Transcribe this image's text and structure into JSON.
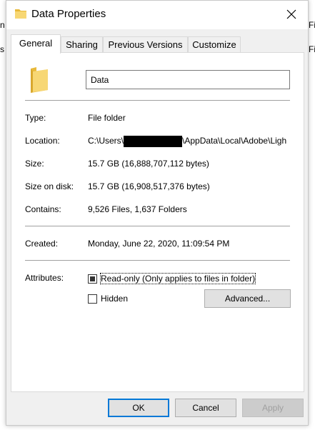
{
  "background": {
    "left_fragments": [
      "n",
      "s"
    ],
    "right_fragments": [
      "Fi",
      "Fi"
    ]
  },
  "window": {
    "title": "Data Properties",
    "close_icon": "close-icon"
  },
  "tabs": [
    {
      "label": "General",
      "active": true
    },
    {
      "label": "Sharing",
      "active": false
    },
    {
      "label": "Previous Versions",
      "active": false
    },
    {
      "label": "Customize",
      "active": false
    }
  ],
  "general": {
    "folder_name": "Data",
    "type": {
      "label": "Type:",
      "value": "File folder"
    },
    "location": {
      "label": "Location:",
      "prefix": "C:\\Users\\",
      "suffix": "\\AppData\\Local\\Adobe\\Ligh"
    },
    "size": {
      "label": "Size:",
      "value": "15.7 GB (16,888,707,112 bytes)"
    },
    "size_on_disk": {
      "label": "Size on disk:",
      "value": "15.7 GB (16,908,517,376 bytes)"
    },
    "contains": {
      "label": "Contains:",
      "value": "9,526 Files, 1,637 Folders"
    },
    "created": {
      "label": "Created:",
      "value": "Monday, June 22, 2020, 11:09:54 PM"
    },
    "attributes": {
      "label": "Attributes:",
      "readonly_label": "Read-only (Only applies to files in folder)",
      "readonly_state": "indeterminate",
      "hidden_label": "Hidden",
      "hidden_checked": false,
      "advanced_label": "Advanced..."
    }
  },
  "buttons": {
    "ok": "OK",
    "cancel": "Cancel",
    "apply": "Apply"
  },
  "colors": {
    "accent": "#0078d7",
    "folder_yellow": "#f7d774",
    "redaction": "#000000"
  }
}
